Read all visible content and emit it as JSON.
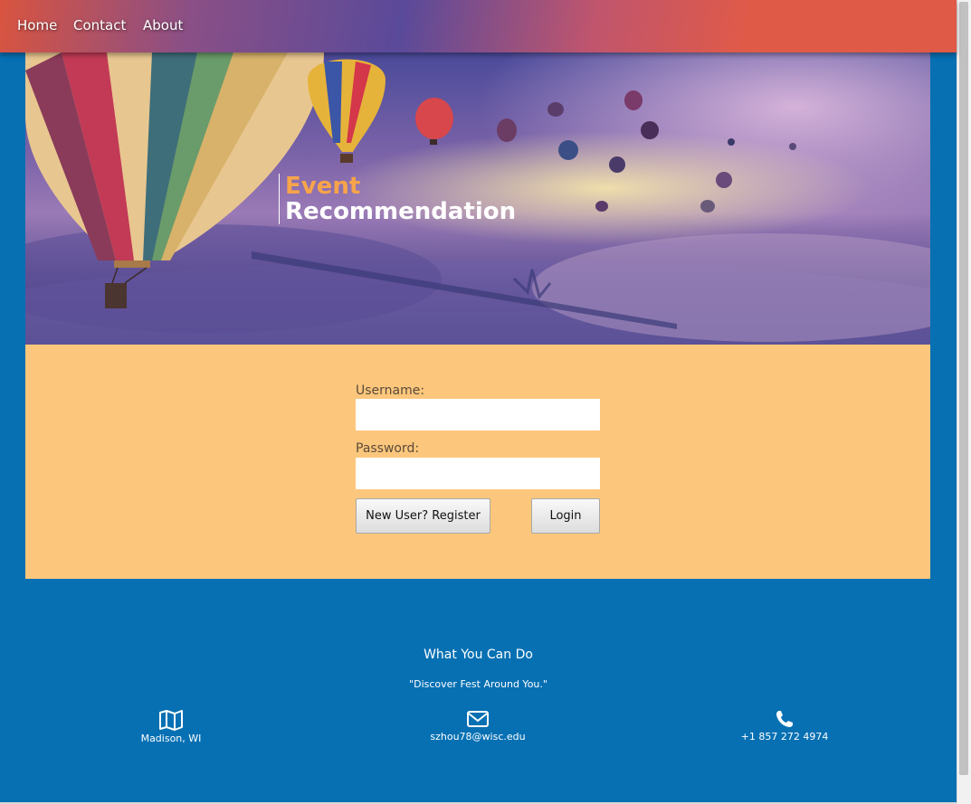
{
  "nav": {
    "home": "Home",
    "contact": "Contact",
    "about": "About"
  },
  "hero": {
    "title_line1": "Event",
    "title_line2": "Recommendation"
  },
  "login": {
    "username_label": "Username:",
    "username_value": "",
    "password_label": "Password:",
    "password_value": "",
    "register_button": "New User? Register",
    "login_button": "Login"
  },
  "footer": {
    "heading": "What You Can Do",
    "quote": "\"Discover Fest Around You.\"",
    "contacts": [
      {
        "icon": "map-icon",
        "text": "Madison, WI"
      },
      {
        "icon": "envelope-icon",
        "text": "szhou78@wisc.edu"
      },
      {
        "icon": "phone-icon",
        "text": "+1 857 272 4974"
      }
    ]
  },
  "colors": {
    "page_background": "#0670b3",
    "login_panel": "#fcc77c",
    "title_accent": "#f7a44a"
  }
}
